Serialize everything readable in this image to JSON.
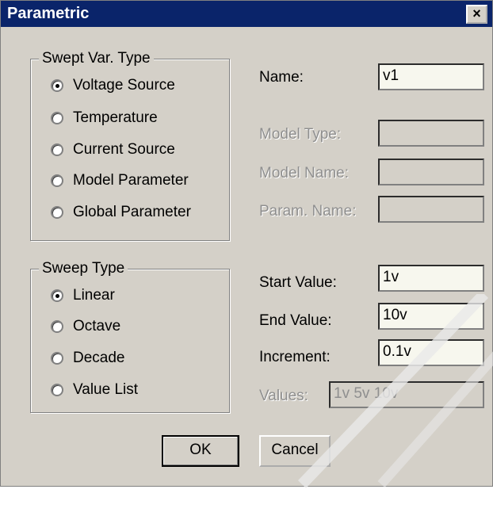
{
  "window": {
    "title": "Parametric",
    "close_label": "×"
  },
  "swept_var_type": {
    "legend": "Swept Var. Type",
    "options": [
      {
        "label": "Voltage Source",
        "selected": true
      },
      {
        "label": "Temperature",
        "selected": false
      },
      {
        "label": "Current Source",
        "selected": false
      },
      {
        "label": "Model Parameter",
        "selected": false
      },
      {
        "label": "Global Parameter",
        "selected": false
      }
    ]
  },
  "sweep_type": {
    "legend": "Sweep Type",
    "options": [
      {
        "label": "Linear",
        "selected": true
      },
      {
        "label": "Octave",
        "selected": false
      },
      {
        "label": "Decade",
        "selected": false
      },
      {
        "label": "Value List",
        "selected": false
      }
    ]
  },
  "fields": {
    "name": {
      "label": "Name:",
      "value": "v1"
    },
    "model_type": {
      "label": "Model Type:",
      "value": ""
    },
    "model_name": {
      "label": "Model Name:",
      "value": ""
    },
    "param_name": {
      "label": "Param. Name:",
      "value": ""
    },
    "start_value": {
      "label": "Start Value:",
      "value": "1v"
    },
    "end_value": {
      "label": "End Value:",
      "value": "10v"
    },
    "increment": {
      "label": "Increment:",
      "value": "0.1v"
    },
    "values": {
      "label": "Values:",
      "value": "1v 5v 10v"
    }
  },
  "buttons": {
    "ok": "OK",
    "cancel": "Cancel"
  },
  "colors": {
    "title_bar": "#0a246a",
    "dialog_bg": "#d4d0c8",
    "field_bg": "#f7f7ee"
  }
}
